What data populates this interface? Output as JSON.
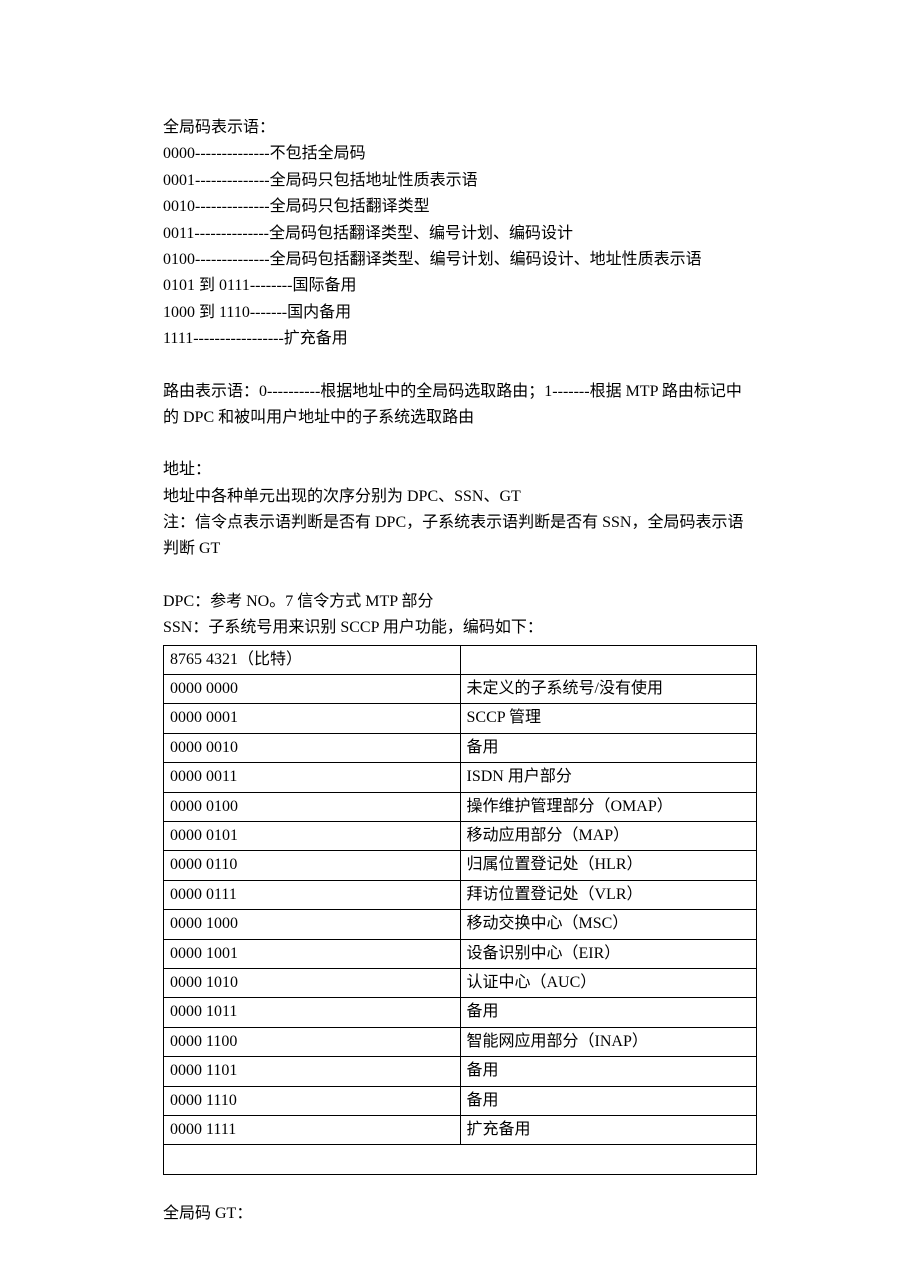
{
  "section1": {
    "title": "全局码表示语：",
    "lines": [
      {
        "code": "0000--------------",
        "desc": "不包括全局码"
      },
      {
        "code": "0001--------------",
        "desc": "全局码只包括地址性质表示语"
      },
      {
        "code": "0010--------------",
        "desc": "全局码只包括翻译类型"
      },
      {
        "code": "0011--------------",
        "desc": "全局码包括翻译类型、编号计划、编码设计"
      },
      {
        "code": "0100--------------",
        "desc": "全局码包括翻译类型、编号计划、编码设计、地址性质表示语"
      },
      {
        "code": "0101 到 0111--------",
        "desc": "国际备用"
      },
      {
        "code": "1000 到 1110-------",
        "desc": "国内备用"
      },
      {
        "code": "1111-----------------",
        "desc": "扩充备用"
      }
    ]
  },
  "section2": {
    "text": "路由表示语：0----------根据地址中的全局码选取路由；1-------根据 MTP 路由标记中的 DPC 和被叫用户地址中的子系统选取路由"
  },
  "section3": {
    "title": "地址：",
    "line1": "地址中各种单元出现的次序分别为 DPC、SSN、GT",
    "line2": "注：信令点表示语判断是否有 DPC，子系统表示语判断是否有 SSN，全局码表示语判断 GT"
  },
  "section4": {
    "line1": "DPC：参考 NO。7 信令方式 MTP 部分",
    "line2": "SSN：子系统号用来识别 SCCP 用户功能，编码如下："
  },
  "table": {
    "rows": [
      {
        "code": "8765   4321（比特）",
        "desc": ""
      },
      {
        "code": "0000   0000",
        "desc": "未定义的子系统号/没有使用"
      },
      {
        "code": "0000   0001",
        "desc": "SCCP 管理"
      },
      {
        "code": "0000   0010",
        "desc": "备用"
      },
      {
        "code": "0000   0011",
        "desc": "ISDN 用户部分"
      },
      {
        "code": "0000   0100",
        "desc": "操作维护管理部分（OMAP）"
      },
      {
        "code": "0000   0101",
        "desc": "移动应用部分（MAP）"
      },
      {
        "code": "0000   0110",
        "desc": "归属位置登记处（HLR）"
      },
      {
        "code": "0000   0111",
        "desc": "拜访位置登记处（VLR）"
      },
      {
        "code": "0000   1000",
        "desc": "移动交换中心（MSC）"
      },
      {
        "code": "0000   1001",
        "desc": "设备识别中心（EIR）"
      },
      {
        "code": "0000   1010",
        "desc": "认证中心（AUC）"
      },
      {
        "code": "0000   1011",
        "desc": "备用"
      },
      {
        "code": "0000   1100",
        "desc": "智能网应用部分（INAP）"
      },
      {
        "code": "0000   1101",
        "desc": "备用"
      },
      {
        "code": "0000   1110",
        "desc": "备用"
      },
      {
        "code": "0000   1111",
        "desc": "扩充备用"
      }
    ]
  },
  "footer": {
    "text": "全局码 GT："
  }
}
